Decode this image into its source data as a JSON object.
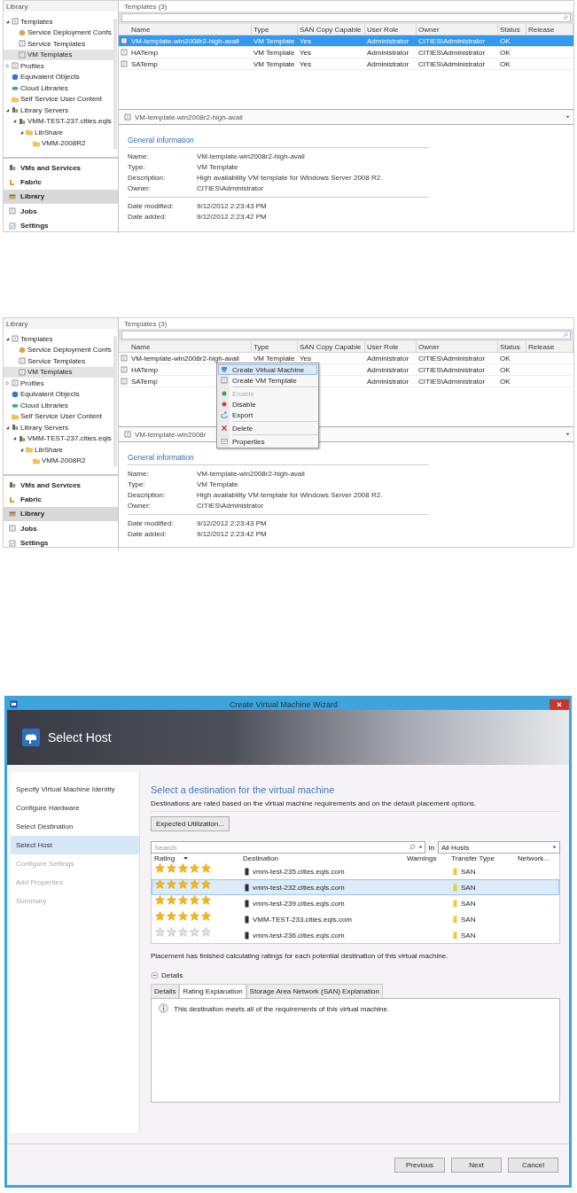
{
  "screens": [
    {
      "nav_title": "Library",
      "tree": [
        {
          "label": "Templates",
          "expanded": true,
          "selected": false,
          "children": [
            {
              "label": "Service Deployment Confs",
              "selected": false
            },
            {
              "label": "Service Templates",
              "selected": false
            },
            {
              "label": "VM Templates",
              "selected": true
            }
          ]
        },
        {
          "label": "Profiles",
          "expanded": false,
          "selected": false
        },
        {
          "label": "Equivalent Objects",
          "selected": false
        },
        {
          "label": "Cloud Libraries",
          "selected": false
        },
        {
          "label": "Self Service User Content",
          "selected": false
        },
        {
          "label": "Library Servers",
          "expanded": true,
          "selected": false,
          "children": [
            {
              "label": "VMM-TEST-237.cities.eqls",
              "expanded": true,
              "selected": false,
              "children": [
                {
                  "label": "LibShare",
                  "expanded": true,
                  "selected": false,
                  "children": [
                    {
                      "label": "VMM-2008R2",
                      "selected": false
                    }
                  ]
                }
              ]
            }
          ]
        }
      ],
      "workspaces": [
        {
          "label": "VMs and Services",
          "selected": false
        },
        {
          "label": "Fabric",
          "selected": false
        },
        {
          "label": "Library",
          "selected": true
        },
        {
          "label": "Jobs",
          "selected": false
        },
        {
          "label": "Settings",
          "selected": false
        }
      ],
      "pane_title": "Templates (3)",
      "columns": [
        "Name",
        "Type",
        "SAN Copy Capable",
        "User Role",
        "Owner",
        "Status",
        "Release"
      ],
      "rows": [
        {
          "name": "VM-template-win2008r2-high-avail",
          "type": "VM Template",
          "san_copy_capable": "Yes",
          "user_role": "Administrator",
          "owner": "CITIES\\Administrator",
          "status": "OK",
          "selected": true
        },
        {
          "name": "HATemp",
          "type": "VM Template",
          "san_copy_capable": "Yes",
          "user_role": "Administrator",
          "owner": "CITIES\\Administrator",
          "status": "OK",
          "selected": false
        },
        {
          "name": "SATemp",
          "type": "VM Template",
          "san_copy_capable": "Yes",
          "user_role": "Administrator",
          "owner": "CITIES\\Administrator",
          "status": "OK",
          "selected": false
        }
      ],
      "detail_title": "VM-template-win2008r2-high-avail",
      "section_title": "General information",
      "property_groups": [
        [
          {
            "label": "Name:",
            "value": "VM-template-win2008r2-high-avail"
          },
          {
            "label": "Type:",
            "value": "VM Template"
          },
          {
            "label": "Description:",
            "value": "High availability VM template for Windows Server 2008 R2."
          },
          {
            "label": "Owner:",
            "value": "CITIES\\Administrator"
          }
        ],
        [
          {
            "label": "Date modified:",
            "value": "9/12/2012 2:23:43 PM"
          },
          {
            "label": "Date added:",
            "value": "9/12/2012 2:23:42 PM"
          }
        ]
      ]
    },
    {
      "nav_title": "Library",
      "tree": [
        {
          "label": "Templates",
          "expanded": true,
          "selected": false,
          "children": [
            {
              "label": "Service Deployment Confs",
              "selected": false
            },
            {
              "label": "Service Templates",
              "selected": false
            },
            {
              "label": "VM Templates",
              "selected": true
            }
          ]
        },
        {
          "label": "Profiles",
          "expanded": false,
          "selected": false
        },
        {
          "label": "Equivalent Objects",
          "selected": false
        },
        {
          "label": "Cloud Libraries",
          "selected": false
        },
        {
          "label": "Self Service User Content",
          "selected": false
        },
        {
          "label": "Library Servers",
          "expanded": true,
          "selected": false,
          "children": [
            {
              "label": "VMM-TEST-237.cities.eqls",
              "expanded": true,
              "selected": false,
              "children": [
                {
                  "label": "LibShare",
                  "expanded": true,
                  "selected": false,
                  "children": [
                    {
                      "label": "VMM-2008R2",
                      "selected": false
                    }
                  ]
                }
              ]
            }
          ]
        }
      ],
      "workspaces": [
        {
          "label": "VMs and Services",
          "selected": false
        },
        {
          "label": "Fabric",
          "selected": false
        },
        {
          "label": "Library",
          "selected": true
        },
        {
          "label": "Jobs",
          "selected": false
        },
        {
          "label": "Settings",
          "selected": false
        }
      ],
      "pane_title": "Templates (3)",
      "columns": [
        "Name",
        "Type",
        "SAN Copy Capable",
        "User Role",
        "Owner",
        "Status",
        "Release"
      ],
      "rows": [
        {
          "name": "VM-template-win2008r2-high-avail",
          "type": "VM Template",
          "san_copy_capable": "Yes",
          "user_role": "Administrator",
          "owner": "CITIES\\Administrator",
          "status": "OK",
          "selected": false
        },
        {
          "name": "HATemp",
          "user_role": "Administrator",
          "owner": "CITIES\\Administrator",
          "status": "OK",
          "selected": false
        },
        {
          "name": "SATemp",
          "user_role": "Administrator",
          "owner": "CITIES\\Administrator",
          "status": "OK",
          "selected": false
        }
      ],
      "detail_title": "VM-template-win2008r",
      "section_title": "General information",
      "property_groups": [
        [
          {
            "label": "Name:",
            "value": "VM-template-win2008r2-high-avail"
          },
          {
            "label": "Type:",
            "value": "VM Template"
          },
          {
            "label": "Description:",
            "value": "High availability VM template for Windows Server 2008 R2."
          },
          {
            "label": "Owner:",
            "value": "CITIES\\Administrator"
          }
        ],
        [
          {
            "label": "Date modified:",
            "value": "9/12/2012 2:23:43 PM"
          },
          {
            "label": "Date added:",
            "value": "9/12/2012 2:23:42 PM"
          }
        ]
      ],
      "context_menu": {
        "groups": [
          [
            {
              "label": "Create Virtual Machine",
              "selected": true,
              "disabled": false
            },
            {
              "label": "Create VM Template",
              "selected": false,
              "disabled": false
            }
          ],
          [
            {
              "label": "Enable",
              "selected": false,
              "disabled": true
            },
            {
              "label": "Disable",
              "selected": false,
              "disabled": false
            },
            {
              "label": "Export",
              "selected": false,
              "disabled": false
            }
          ],
          [
            {
              "label": "Delete",
              "selected": false,
              "disabled": false
            }
          ],
          [
            {
              "label": "Properties",
              "selected": false,
              "disabled": false
            }
          ]
        ]
      }
    }
  ],
  "wizard": {
    "title": "Create Virtual Machine Wizard",
    "page_title": "Select Host",
    "steps": [
      {
        "label": "Specify Virtual Machine Identity",
        "selected": false,
        "disabled": false
      },
      {
        "label": "Configure Hardware",
        "selected": false,
        "disabled": false
      },
      {
        "label": "Select Destination",
        "selected": false,
        "disabled": false
      },
      {
        "label": "Select Host",
        "selected": true,
        "disabled": false
      },
      {
        "label": "Configure Settings",
        "selected": false,
        "disabled": true
      },
      {
        "label": "Add Properties",
        "selected": false,
        "disabled": true
      },
      {
        "label": "Summary",
        "selected": false,
        "disabled": true
      }
    ],
    "heading": "Select a destination for the virtual machine",
    "description": "Destinations are rated based on the virtual machine requirements and on the default placement options.",
    "utilization_button": "Expected Utilization...",
    "search": {
      "placeholder": "Search"
    },
    "scope_label": "in",
    "scope": "All Hosts",
    "columns": [
      "Rating",
      "Destination",
      "Warnings",
      "Transfer Type",
      "Network…"
    ],
    "hosts": [
      {
        "stars": 5,
        "destination": "vmm-test-235.cities.eqls.com",
        "transfer_type": "SAN",
        "selected": false
      },
      {
        "stars": 5,
        "destination": "vmm-test-232.cities.eqls.com",
        "transfer_type": "SAN",
        "selected": true
      },
      {
        "stars": 5,
        "destination": "vmm-test-239.cities.eqls.com",
        "transfer_type": "SAN",
        "selected": false
      },
      {
        "stars": 5,
        "destination": "VMM-TEST-233.cities.eqls.com",
        "transfer_type": "SAN",
        "selected": false
      },
      {
        "stars": 0,
        "destination": "vmm-test-236.cities.eqls.com",
        "transfer_type": "SAN",
        "selected": false
      }
    ],
    "status": "Placement has finished calculating ratings for each potential destination of this virtual machine.",
    "details_label": "Details",
    "details_expanded": true,
    "tabs": [
      {
        "label": "Details",
        "selected": false
      },
      {
        "label": "Rating Explanation",
        "selected": true
      },
      {
        "label": "Storage Area Network (SAN) Explanation",
        "selected": false
      }
    ],
    "message": "This destination meets all of the requirements of this virtual machine.",
    "buttons": [
      "Previous",
      "Next",
      "Cancel"
    ]
  }
}
